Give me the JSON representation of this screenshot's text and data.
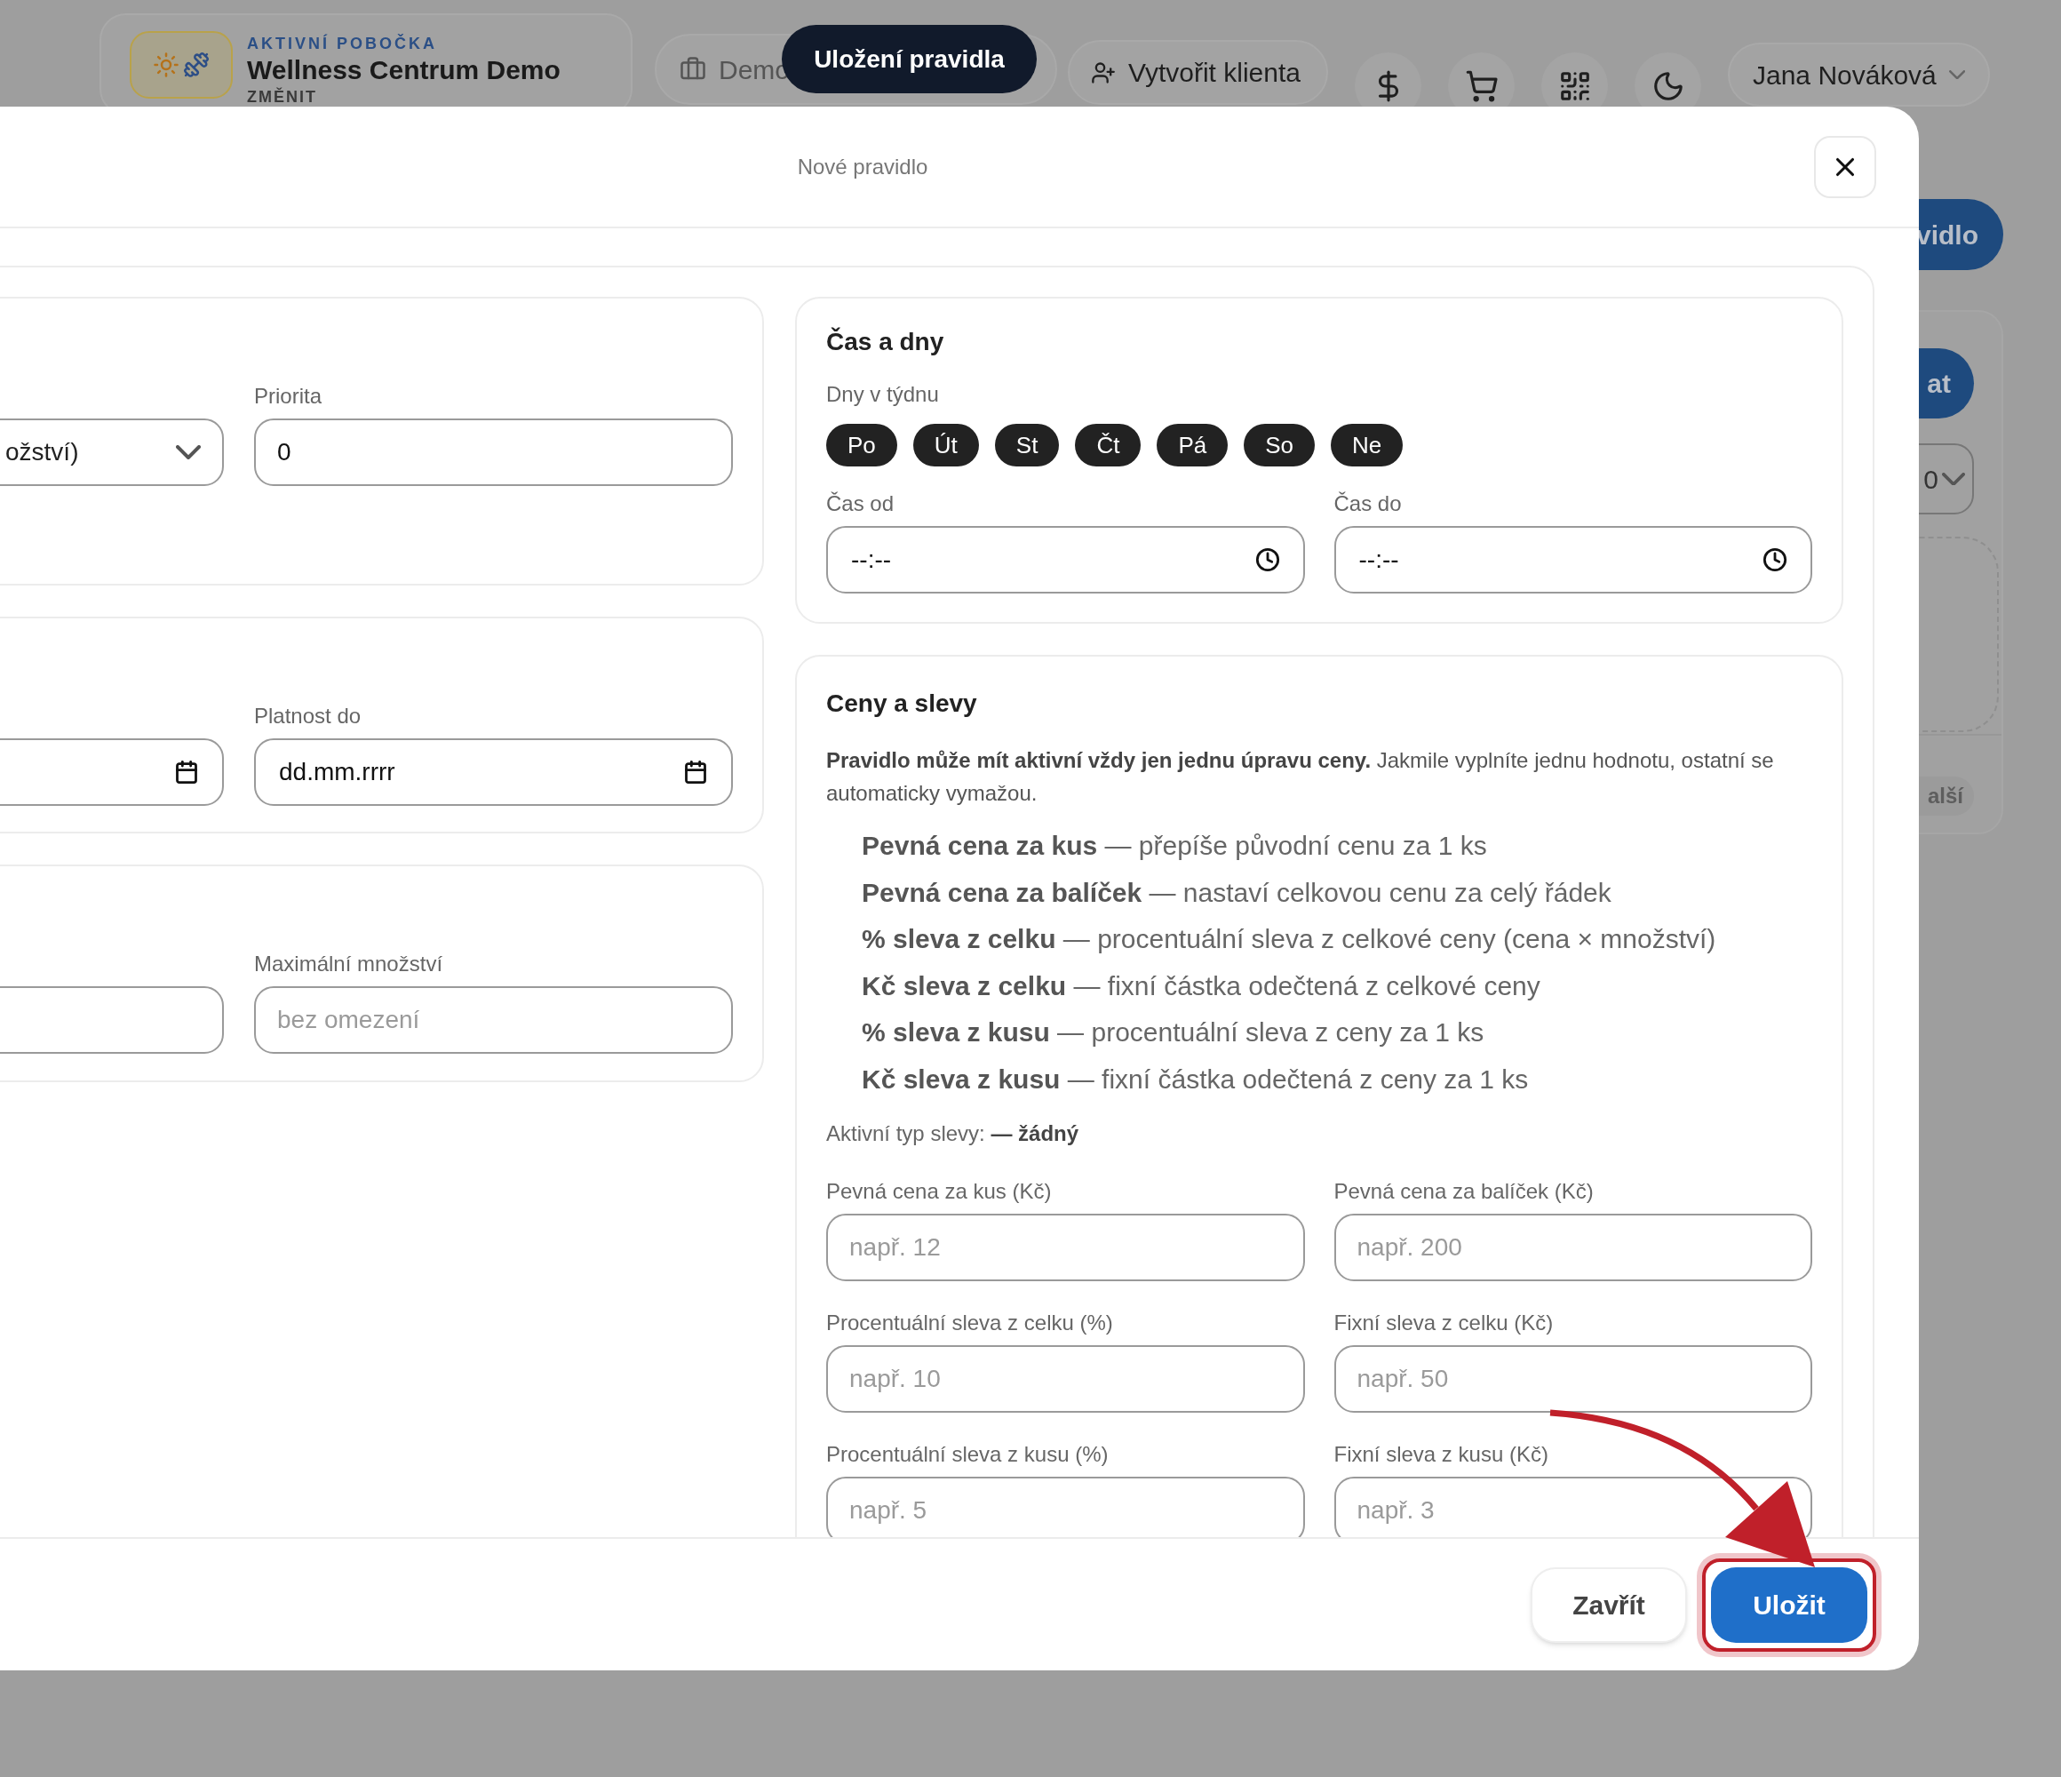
{
  "background": {
    "branch": {
      "caption": "AKTIVNÍ POBOČKA",
      "name": "Wellness Centrum Demo",
      "action": "ZMĚNIT"
    },
    "location_pill": "Demo",
    "create_client_button": "Vytvořit klienta",
    "user_menu": "Jana Nováková",
    "rule_button": "vidlo",
    "panel": {
      "primary_button": "at",
      "page_size": "0",
      "next_button": "alší"
    }
  },
  "toast": "Uložení pravidla",
  "dialog": {
    "title": "Nové pravidlo",
    "left_cards": [
      {
        "fields": [
          {
            "kind": "select",
            "value": "ožství)"
          },
          {
            "kind": "text",
            "label": "Priorita",
            "value": "0"
          }
        ]
      },
      {
        "fields": [
          {
            "kind": "date"
          },
          {
            "kind": "date",
            "label": "Platnost do",
            "value": "dd.mm.rrrr"
          }
        ]
      },
      {
        "fields": [
          {
            "kind": "text"
          },
          {
            "kind": "text",
            "label": "Maximální množství",
            "placeholder": "bez omezení"
          }
        ]
      }
    ],
    "time_card": {
      "title": "Čas a dny",
      "days_label": "Dny v týdnu",
      "days": [
        {
          "label": "Po",
          "selected": true
        },
        {
          "label": "Út",
          "selected": true
        },
        {
          "label": "St",
          "selected": true
        },
        {
          "label": "Čt",
          "selected": true
        },
        {
          "label": "Pá",
          "selected": true
        },
        {
          "label": "So",
          "selected": true
        },
        {
          "label": "Ne",
          "selected": true
        }
      ],
      "fields": [
        {
          "kind": "time",
          "label": "Čas od",
          "value": "--:--"
        },
        {
          "kind": "time",
          "label": "Čas do",
          "value": "--:--"
        }
      ]
    },
    "pricing_card": {
      "title": "Ceny a slevy",
      "note": "**Pravidlo může mít aktivní vždy jen jednu úpravu ceny.** Jakmile vyplníte jednu hodnotu, ostatní se automaticky vymažou.",
      "options": [
        "**Pevná cena za kus** — přepíše původní cenu za 1 ks",
        "**Pevná cena za balíček** — nastaví celkovou cenu za celý řádek",
        "**% sleva z celku** — procentuální sleva z celkové ceny (cena × množství)",
        "**Kč sleva z celku** — fixní částka odečtená z celkové ceny",
        "**% sleva z kusu** — procentuální sleva z ceny za 1 ks",
        "**Kč sleva z kusu** — fixní částka odečtená z ceny za 1 ks"
      ],
      "active_type": "Aktivní typ slevy: **— žádný**",
      "fields": [
        {
          "kind": "text",
          "label": "Pevná cena za kus (Kč)",
          "placeholder": "např. 12"
        },
        {
          "kind": "text",
          "label": "Pevná cena za balíček (Kč)",
          "placeholder": "např. 200"
        },
        {
          "kind": "text",
          "label": "Procentuální sleva z celku (%)",
          "placeholder": "např. 10"
        },
        {
          "kind": "text",
          "label": "Fixní sleva z celku (Kč)",
          "placeholder": "např. 50"
        },
        {
          "kind": "text",
          "label": "Procentuální sleva z kusu (%)",
          "placeholder": "např. 5"
        },
        {
          "kind": "text",
          "label": "Fixní sleva z kusu (Kč)",
          "placeholder": "např. 3"
        }
      ]
    },
    "buttons": [
      {
        "kind": "secondary",
        "label": "Zavřít",
        "highlighted": false
      },
      {
        "kind": "primary",
        "label": "Uložit",
        "highlighted": true
      }
    ]
  }
}
